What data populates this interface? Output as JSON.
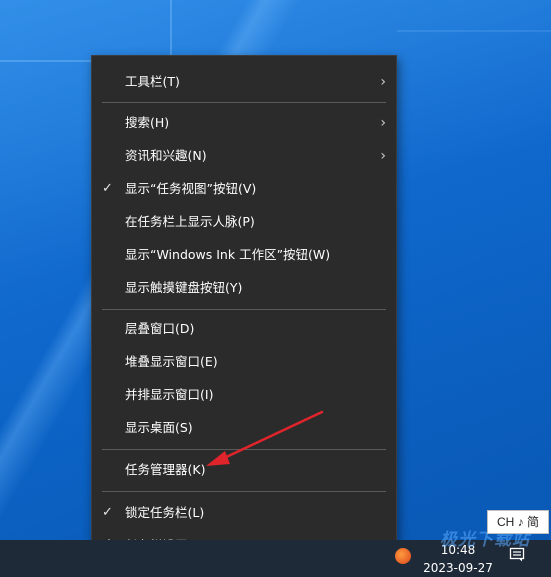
{
  "context_menu": {
    "items": [
      {
        "label": "工具栏(T)",
        "submenu": true,
        "checked": false
      },
      {
        "label": "搜索(H)",
        "submenu": true,
        "checked": false
      },
      {
        "label": "资讯和兴趣(N)",
        "submenu": true,
        "checked": false
      },
      {
        "label": "显示“任务视图”按钮(V)",
        "submenu": false,
        "checked": true
      },
      {
        "label": "在任务栏上显示人脉(P)",
        "submenu": false,
        "checked": false
      },
      {
        "label": "显示“Windows Ink 工作区”按钮(W)",
        "submenu": false,
        "checked": false
      },
      {
        "label": "显示触摸键盘按钮(Y)",
        "submenu": false,
        "checked": false
      },
      {
        "label": "层叠窗口(D)",
        "submenu": false,
        "checked": false
      },
      {
        "label": "堆叠显示窗口(E)",
        "submenu": false,
        "checked": false
      },
      {
        "label": "并排显示窗口(I)",
        "submenu": false,
        "checked": false
      },
      {
        "label": "显示桌面(S)",
        "submenu": false,
        "checked": false
      },
      {
        "label": "任务管理器(K)",
        "submenu": false,
        "checked": false
      },
      {
        "label": "锁定任务栏(L)",
        "submenu": false,
        "checked": true
      },
      {
        "label": "任务栏设置(T)",
        "submenu": false,
        "checked": false,
        "icon": "gear-icon"
      }
    ],
    "check_glyph": "✓",
    "arrow_glyph": "›"
  },
  "taskbar": {
    "time": "10:48",
    "date": "2023-09-27",
    "ime_indicator": "CH ♪ 简"
  },
  "annotation": {
    "arrow_color": "#e0242b",
    "points_to": "任务管理器(K)"
  },
  "watermark": "极光下载站"
}
